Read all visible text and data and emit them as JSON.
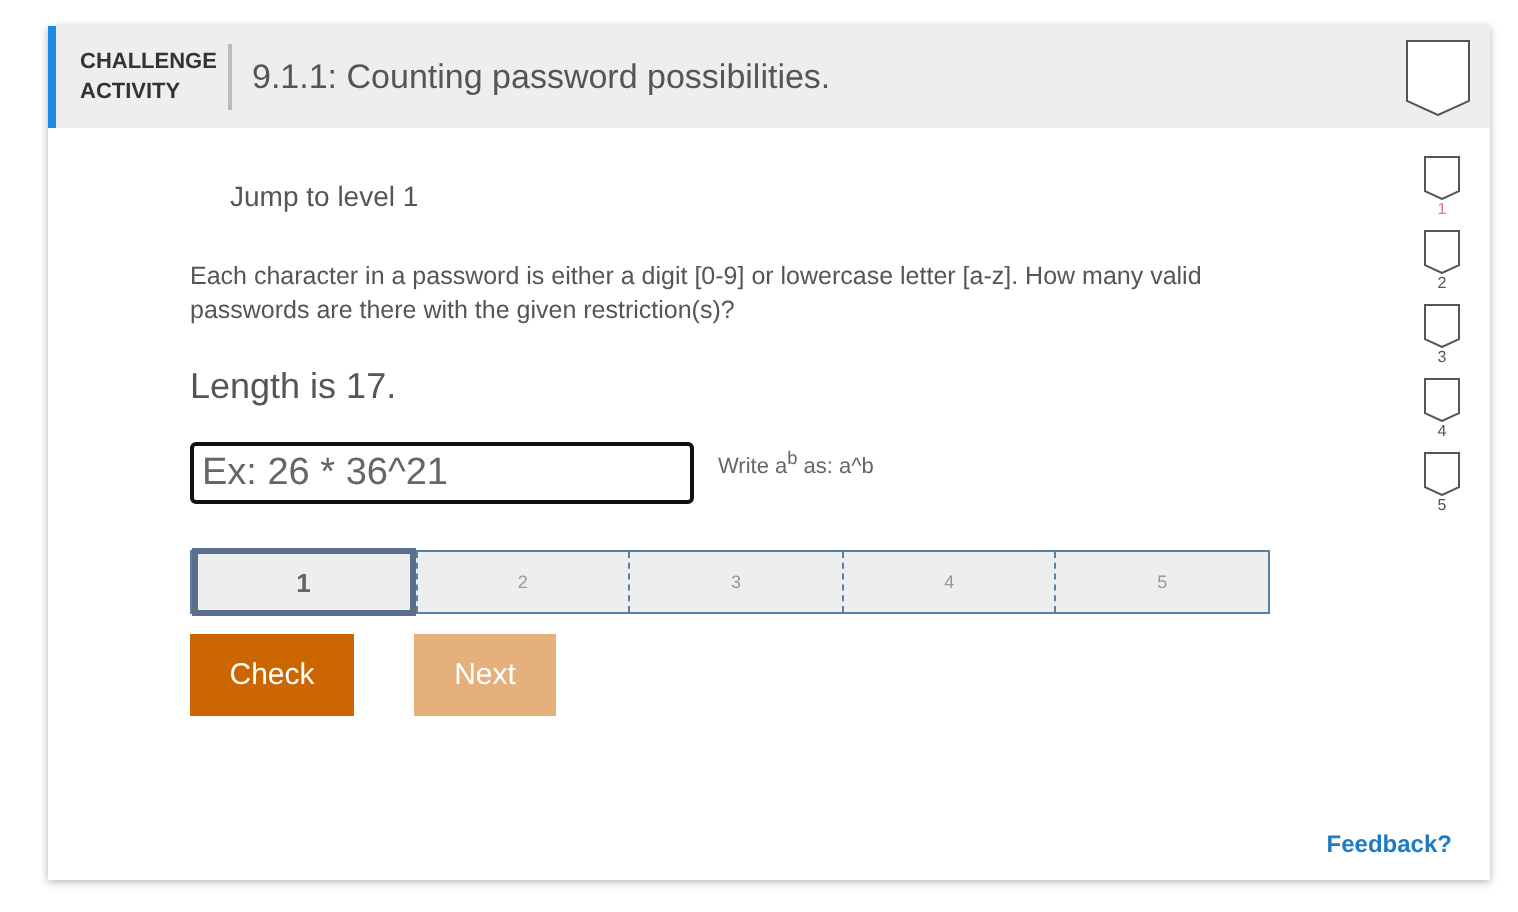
{
  "header": {
    "kind_label": "CHALLENGE ACTIVITY",
    "title": "9.1.1: Counting password possibilities."
  },
  "jump_link": "Jump to level 1",
  "prompt": "Each character in a password is either a digit [0-9] or lowercase letter [a-z]. How many valid passwords are there with the given restriction(s)?",
  "restriction": "Length is 17.",
  "answer": {
    "placeholder": "Ex: 26 * 36^21"
  },
  "hint": "Write a$^{b}$ as: a^b",
  "steps": [
    {
      "label": "1",
      "selected": true
    },
    {
      "label": "2",
      "selected": false
    },
    {
      "label": "3",
      "selected": false
    },
    {
      "label": "4",
      "selected": false
    },
    {
      "label": "5",
      "selected": false
    }
  ],
  "buttons": [
    {
      "label": "Check",
      "disabled": false
    },
    {
      "label": "Next",
      "disabled": true
    }
  ],
  "levels": [
    {
      "label": "1",
      "selected": true
    },
    {
      "label": "2",
      "selected": false
    },
    {
      "label": "3",
      "selected": false
    },
    {
      "label": "4",
      "selected": false
    },
    {
      "label": "5",
      "selected": false
    }
  ],
  "feedback": "Feedback?"
}
